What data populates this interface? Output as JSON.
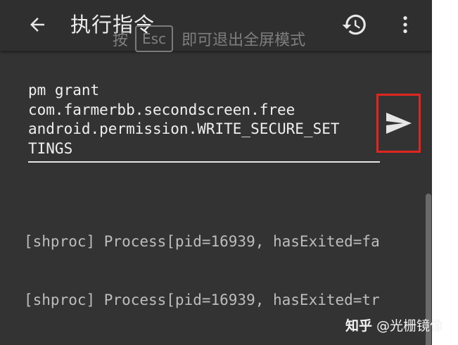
{
  "appbar": {
    "title": "执行指令",
    "back_icon": "arrow-left-icon",
    "history_icon": "history-icon",
    "more_icon": "more-vert-icon"
  },
  "esc_hint": {
    "prefix": "按",
    "key": "Esc",
    "suffix": "即可退出全屏模式"
  },
  "command": {
    "lines": [
      "pm grant",
      "com.farmerbb.secondscreen.free",
      "android.permission.WRITE_SECURE_SET",
      "TINGS"
    ],
    "send_icon": "send-icon"
  },
  "output": {
    "lines": [
      "[shproc] Process[pid=16939, hasExited=fa",
      "[shproc] Process[pid=16939, hasExited=tr"
    ]
  },
  "watermark": {
    "brand": "知乎",
    "author": "@光栅镜像"
  },
  "colors": {
    "background": "#333333",
    "appbar": "#2f2f2f",
    "highlight_border": "#e0261f",
    "text": "#f0f0f0",
    "output_text": "#bdbdbd"
  }
}
